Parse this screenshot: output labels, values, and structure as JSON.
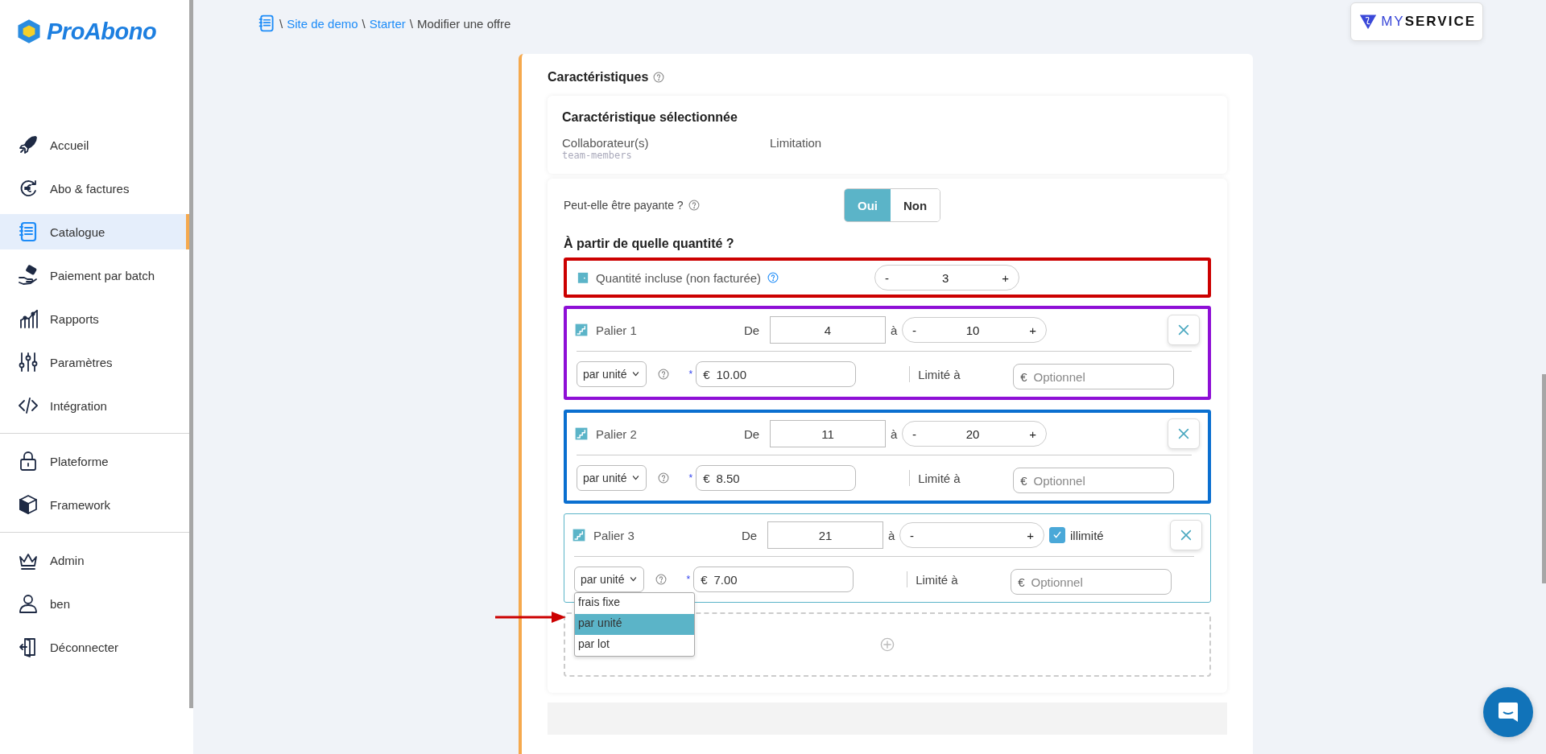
{
  "sidebar": {
    "logo": "ProAbono",
    "groups": [
      [
        {
          "label": "Accueil",
          "selected": false
        },
        {
          "label": "Abo & factures",
          "selected": false
        },
        {
          "label": "Catalogue",
          "selected": true
        },
        {
          "label": "Paiement par batch",
          "selected": false
        },
        {
          "label": "Rapports",
          "selected": false
        },
        {
          "label": "Paramètres",
          "selected": false
        },
        {
          "label": "Intégration",
          "selected": false
        }
      ],
      [
        {
          "label": "Plateforme",
          "selected": false
        },
        {
          "label": "Framework",
          "selected": false
        }
      ],
      [
        {
          "label": "Admin",
          "selected": false
        },
        {
          "label": "ben",
          "selected": false
        },
        {
          "label": "Déconnecter",
          "selected": false
        }
      ]
    ]
  },
  "breadcrumb": [
    {
      "label": "Site de demo",
      "kind": "link",
      "separator": "\\"
    },
    {
      "label": "Starter",
      "kind": "link",
      "separator": "\\"
    },
    {
      "label": "Modifier une offre",
      "kind": "current",
      "separator": "\\"
    }
  ],
  "partner_logo": {
    "accent": "MY",
    "rest": "SERVICE"
  },
  "section": {
    "title": "Caractéristiques"
  },
  "selected_feature": {
    "title": "Caractéristique sélectionnée",
    "name": "Collaborateur(s)",
    "code": "team-members",
    "type": "Limitation"
  },
  "billable": {
    "label": "Peut-elle être payante ?",
    "options": [
      {
        "label": "Oui",
        "selected": true
      },
      {
        "label": "Non",
        "selected": false
      }
    ]
  },
  "quantity_heading": "À partir de quelle quantité ?",
  "included": {
    "label": "Quantité incluse (non facturée)",
    "minus": "-",
    "value": "3",
    "plus": "+",
    "color": "#cc0000"
  },
  "tiers": [
    {
      "label": "Palier 1",
      "from_label": "De",
      "from": "4",
      "to_label": "à",
      "minus": "-",
      "to": "10",
      "plus": "+",
      "color": "#8e0fd6",
      "highlighted": true,
      "pricing": "par unité",
      "expanded": false,
      "required": "*",
      "currency": "€",
      "price": "10.00",
      "limit_label": "Limité à",
      "limit_currency": "€",
      "limit_placeholder": "Optionnel"
    },
    {
      "label": "Palier 2",
      "from_label": "De",
      "from": "11",
      "to_label": "à",
      "minus": "-",
      "to": "20",
      "plus": "+",
      "color": "#0a6fd0",
      "highlighted": true,
      "pricing": "par unité",
      "expanded": false,
      "required": "*",
      "currency": "€",
      "price": "8.50",
      "limit_label": "Limité à",
      "limit_currency": "€",
      "limit_placeholder": "Optionnel"
    },
    {
      "label": "Palier 3",
      "from_label": "De",
      "from": "21",
      "to_label": "à",
      "minus": "-",
      "plus": "+",
      "unlimited": {
        "label": "illimité",
        "checked": true
      },
      "color": "#5bb4c8",
      "highlighted": false,
      "pricing": "par unité",
      "expanded": true,
      "options": [
        {
          "label": "frais fixe",
          "selected": false
        },
        {
          "label": "par unité",
          "selected": true
        },
        {
          "label": "par lot",
          "selected": false
        }
      ],
      "required": "*",
      "currency": "€",
      "price": "7.00",
      "limit_label": "Limité à",
      "limit_currency": "€",
      "limit_placeholder": "Optionnel"
    }
  ]
}
